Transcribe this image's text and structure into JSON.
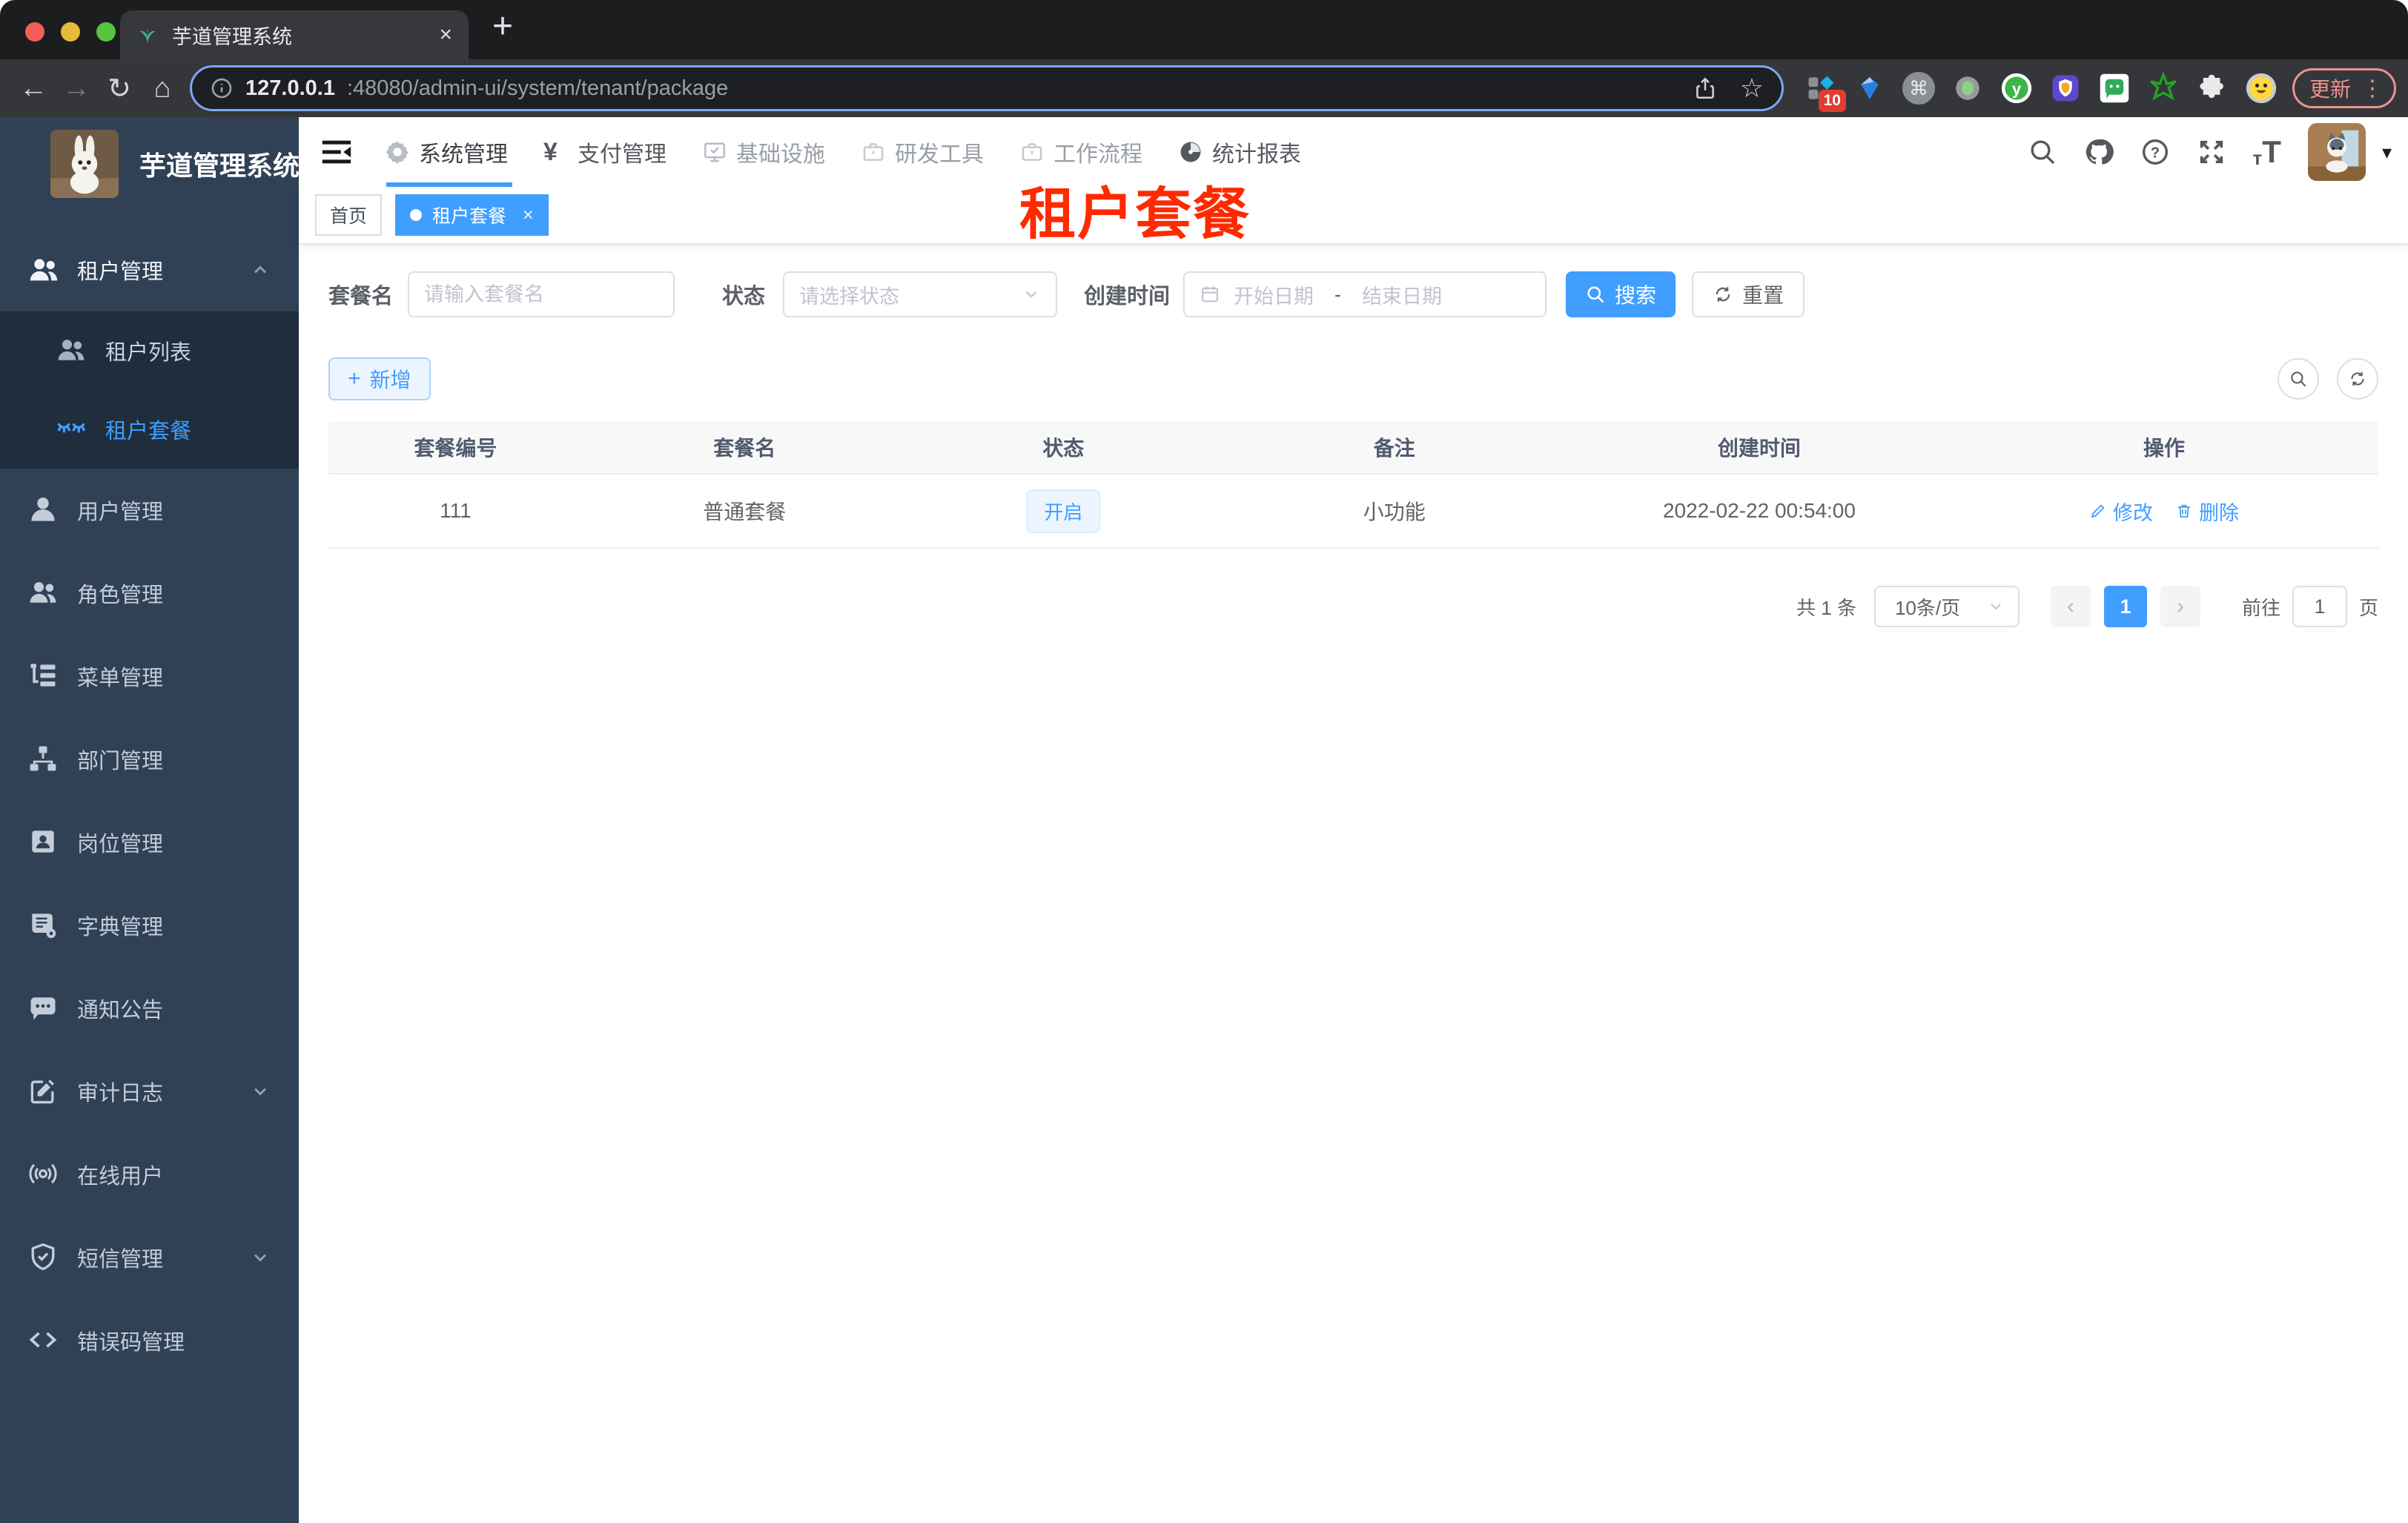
{
  "browser": {
    "tab_title": "芋道管理系统",
    "url_host": "127.0.0.1",
    "url_rest": ":48080/admin-ui/system/tenant/package",
    "update_label": "更新",
    "ext_badge": "10",
    "extensions": [
      "grid-diamond",
      "blue-gem",
      "command",
      "record",
      "y-circle",
      "purple-shield",
      "green-chat",
      "green-star",
      "puzzle",
      "smiley"
    ]
  },
  "icons": {
    "close": "×",
    "plus": "+",
    "back": "←",
    "forward": "→",
    "reload": "↻",
    "home": "⌂",
    "star": "☆",
    "kebab": "⋮",
    "command": "⌘",
    "caret_down": "▾",
    "prev": "‹",
    "next": "›",
    "yen": "¥",
    "question": "?",
    "font_small": "т",
    "font_big": "T",
    "tab_close": "×"
  },
  "sidebar": {
    "title": "芋道管理系统",
    "parent": "租户管理",
    "sub1": "租户列表",
    "sub2": "租户套餐",
    "items": [
      "用户管理",
      "角色管理",
      "菜单管理",
      "部门管理",
      "岗位管理",
      "字典管理",
      "通知公告",
      "审计日志",
      "在线用户",
      "短信管理",
      "错误码管理"
    ]
  },
  "topnav": {
    "items": [
      {
        "label": "系统管理",
        "active": true
      },
      {
        "label": "支付管理"
      },
      {
        "label": "基础设施"
      },
      {
        "label": "研发工具"
      },
      {
        "label": "工作流程"
      },
      {
        "label": "统计报表"
      }
    ]
  },
  "tags": {
    "home": "首页",
    "active": "租户套餐"
  },
  "overlay_title": "租户套餐",
  "filters": {
    "name_label": "套餐名",
    "name_placeholder": "请输入套餐名",
    "status_label": "状态",
    "status_placeholder": "请选择状态",
    "date_label": "创建时间",
    "date_start": "开始日期",
    "date_sep": "-",
    "date_end": "结束日期",
    "search_label": "搜索",
    "reset_label": "重置"
  },
  "toolbar": {
    "add_label": "新增"
  },
  "table": {
    "columns": [
      "套餐编号",
      "套餐名",
      "状态",
      "备注",
      "创建时间",
      "操作"
    ],
    "row": {
      "id": "111",
      "name": "普通套餐",
      "status": "开启",
      "remark": "小功能",
      "created": "2022-02-22 00:54:00",
      "edit": "修改",
      "delete": "删除"
    }
  },
  "pagination": {
    "total": "共 1 条",
    "page_size": "10条/页",
    "page": "1",
    "goto": "前往",
    "goto_value": "1",
    "unit": "页"
  },
  "colors": {
    "accent": "#409eff",
    "sidebar_bg": "#304156",
    "submenu_bg": "#1f2d3d",
    "overlay_red": "#ff2a00",
    "tag_active_bg": "#409eff",
    "status_tag_bg": "#ecf5ff",
    "table_header_bg": "#f8f8f9",
    "chrome_bg": "#35363a",
    "update_pill": "#ed938d"
  }
}
